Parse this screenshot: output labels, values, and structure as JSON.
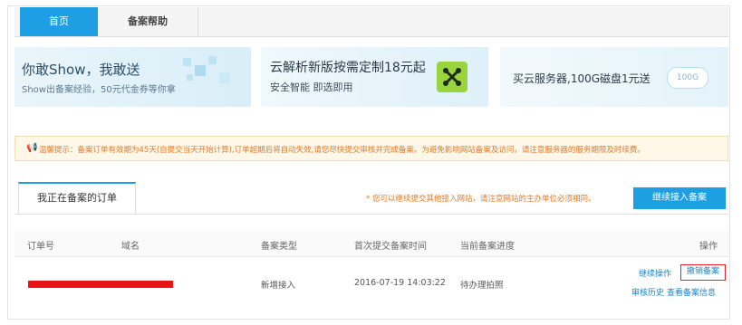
{
  "tabs": {
    "home": "首页",
    "help": "备案帮助"
  },
  "banners": {
    "b1_title": "你敢Show，我敢送",
    "b1_sub": "Show出备案经验，50元代金券等你拿",
    "b2_title": "云解析新版按需定制18元起",
    "b2_sub": "安全智能 即选即用",
    "b3_title": "买云服务器,100G磁盘1元送",
    "b3_tag": "100G"
  },
  "notice": "温馨提示：备案订单有效期为45天(自提交当天开始计算),订单超期后将自动失效,请您尽快提交审核并完成备案。为避免影响网站备案及访问，请注意服务器的服务期限及时续费。",
  "orders": {
    "tab_label": "我正在备案的订单",
    "tip": "* 您可以继续提交其他接入网站，请注意网站的主办单位必须相同。",
    "continue_button": "继续接入备案"
  },
  "table": {
    "headers": {
      "order": "订单号",
      "domain": "域名",
      "type": "备案类型",
      "first_submit": "首次提交备案时间",
      "progress": "当前备案进度",
      "action": "操作"
    },
    "row": {
      "type": "新增接入",
      "time": "2016-07-19 14:03:22",
      "progress": "待办理拍照",
      "actions": {
        "continue": "继续操作",
        "cancel": "撤销备案",
        "history": "审核历史",
        "view": "查看备案信息"
      }
    }
  }
}
